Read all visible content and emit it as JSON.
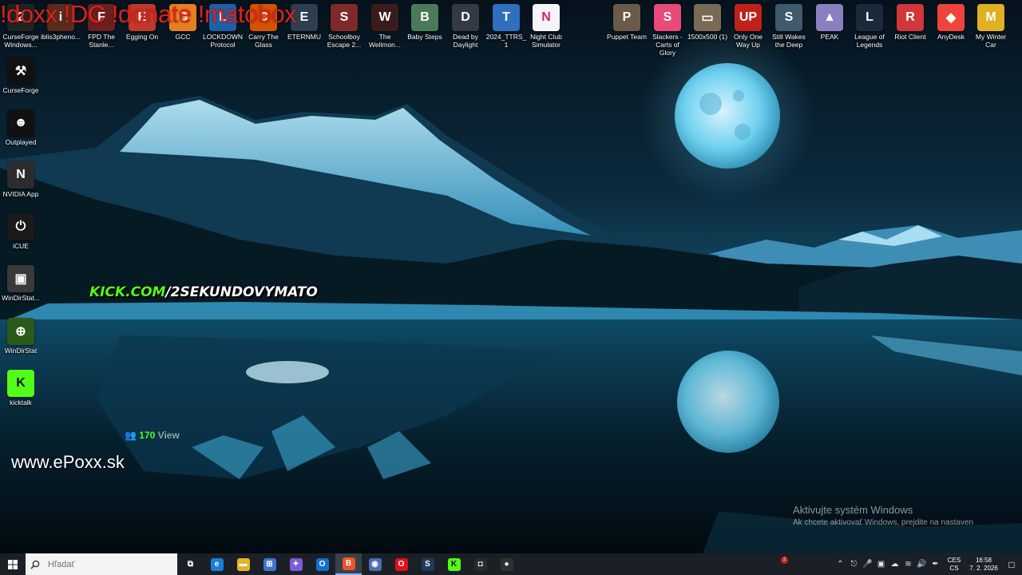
{
  "overlay": {
    "commands": "!doxx !DC !donate !matobox",
    "kick_prefix": "KICK.COM",
    "kick_suffix": "/2SEKUNDOVYMATO",
    "views_number": "170",
    "views_label": "View",
    "website": "www.ePoxx.sk"
  },
  "activation": {
    "title": "Aktivujte systém Windows",
    "subtitle": "Ak chcete aktivovať Windows, prejdite na nastaven"
  },
  "desktop_icons_top": [
    {
      "label": "CurseForge Windows...",
      "color": "#222222",
      "glyph": "2",
      "icon": "curseforge-windows-icon"
    },
    {
      "label": "iblis3pheno...",
      "color": "#5a2b1a",
      "glyph": "i",
      "icon": "iblis-icon"
    },
    {
      "label": "FPD The Stanle...",
      "color": "#6b1f1f",
      "glyph": "F",
      "icon": "fpd-icon"
    },
    {
      "label": "Egging On",
      "color": "#c0392b",
      "glyph": "E",
      "icon": "egging-on-icon"
    },
    {
      "label": "GCC",
      "color": "#e67e22",
      "glyph": "G",
      "icon": "gcc-icon"
    },
    {
      "label": "LOCKDOWN Protocol",
      "color": "#1f5fa8",
      "glyph": "L",
      "icon": "lockdown-protocol-icon"
    },
    {
      "label": "Carry The Glass",
      "color": "#d35400",
      "glyph": "C",
      "icon": "carry-the-glass-icon"
    },
    {
      "label": "ETERNMU",
      "color": "#2c3e50",
      "glyph": "E",
      "icon": "eternmu-icon"
    },
    {
      "label": "Schoolboy Escape 2...",
      "color": "#7f2a2a",
      "glyph": "S",
      "icon": "schoolboy-escape-icon"
    },
    {
      "label": "The Wellmon...",
      "color": "#3b1b1b",
      "glyph": "W",
      "icon": "wellmon-icon"
    },
    {
      "label": "Baby Steps",
      "color": "#4a7a5a",
      "glyph": "B",
      "icon": "baby-steps-icon"
    },
    {
      "label": "Dead by Daylight",
      "color": "#333a45",
      "glyph": "D",
      "icon": "dead-by-daylight-icon"
    },
    {
      "label": "2024_TTRS_1",
      "color": "#2e6fbf",
      "glyph": "T",
      "icon": "file-icon"
    },
    {
      "label": "Night Club Simulator",
      "color": "#f5f5f5",
      "glyph": "N",
      "icon": "night-club-icon"
    },
    {
      "label": "Puppet Team",
      "color": "#6b5a4a",
      "glyph": "P",
      "icon": "puppet-team-icon"
    },
    {
      "label": "Slackers - Carts of Glory",
      "color": "#e84a7a",
      "glyph": "S",
      "icon": "slackers-icon"
    },
    {
      "label": "1500x500 (1)",
      "color": "#7a6a55",
      "glyph": "▭",
      "icon": "image-file-icon"
    },
    {
      "label": "Only One Way Up",
      "color": "#c0201a",
      "glyph": "UP",
      "icon": "only-one-way-up-icon"
    },
    {
      "label": "Still Wakes the Deep",
      "color": "#3f5a6a",
      "glyph": "S",
      "icon": "still-wakes-icon"
    },
    {
      "label": "PEAK",
      "color": "#8a7fc0",
      "glyph": "▲",
      "icon": "peak-icon"
    },
    {
      "label": "League of Legends",
      "color": "#1a2a3a",
      "glyph": "L",
      "icon": "league-of-legends-icon"
    },
    {
      "label": "Riot Client",
      "color": "#d13639",
      "glyph": "R",
      "icon": "riot-client-icon"
    },
    {
      "label": "AnyDesk",
      "color": "#ef443b",
      "glyph": "◆",
      "icon": "anydesk-icon"
    },
    {
      "label": "My Winter Car",
      "color": "#e0b020",
      "glyph": "M",
      "icon": "my-winter-car-icon"
    }
  ],
  "desktop_icons_left": [
    {
      "label": "CurseForge",
      "color": "#111111",
      "glyph": "⚒",
      "icon": "curseforge-icon"
    },
    {
      "label": "Outplayed",
      "color": "#111111",
      "glyph": "☻",
      "icon": "outplayed-icon"
    },
    {
      "label": "NVIDIA App",
      "color": "#2c2c2c",
      "glyph": "N",
      "icon": "nvidia-icon"
    },
    {
      "label": "iCUE",
      "color": "#1a1a1a",
      "glyph": "⏻",
      "icon": "icue-icon"
    },
    {
      "label": "WinDirStat...",
      "color": "#3a3a3a",
      "glyph": "▣",
      "icon": "windirstat-shortcut-icon"
    },
    {
      "label": "WinDirStat",
      "color": "#2b5a1a",
      "glyph": "⊕",
      "icon": "windirstat-icon"
    },
    {
      "label": "kicktalk",
      "color": "#53fc18",
      "glyph": "K",
      "icon": "kicktalk-icon"
    }
  ],
  "taskbar": {
    "search_placeholder": "Hľadať",
    "apps": [
      {
        "name": "task-view",
        "color": "#1b2027",
        "glyph": "⧉",
        "active": false
      },
      {
        "name": "edge",
        "color": "#1a7fd6",
        "glyph": "e",
        "active": false
      },
      {
        "name": "file-explorer",
        "color": "#e6b422",
        "glyph": "▬",
        "active": false
      },
      {
        "name": "microsoft-store",
        "color": "#3b74d1",
        "glyph": "⊞",
        "active": false
      },
      {
        "name": "copilot",
        "color": "#7a5ad6",
        "glyph": "✦",
        "active": false
      },
      {
        "name": "outlook",
        "color": "#1270d0",
        "glyph": "O",
        "active": false
      },
      {
        "name": "brave",
        "color": "#f0532a",
        "glyph": "B",
        "active": true
      },
      {
        "name": "chrome-alt",
        "color": "#4a6fb0",
        "glyph": "◉",
        "active": false
      },
      {
        "name": "opera",
        "color": "#e0101a",
        "glyph": "O",
        "active": false
      },
      {
        "name": "steam",
        "color": "#1f3b5a",
        "glyph": "S",
        "active": false
      },
      {
        "name": "kick",
        "color": "#53fc18",
        "glyph": "K",
        "active": false
      },
      {
        "name": "camera-app",
        "color": "#2a2a2a",
        "glyph": "◘",
        "active": false
      },
      {
        "name": "obs",
        "color": "#303030",
        "glyph": "●",
        "active": false
      }
    ],
    "notification_count": "2",
    "language_top": "CES",
    "language_bottom": "CS",
    "time": "16:58",
    "date": "7. 2. 2026"
  }
}
